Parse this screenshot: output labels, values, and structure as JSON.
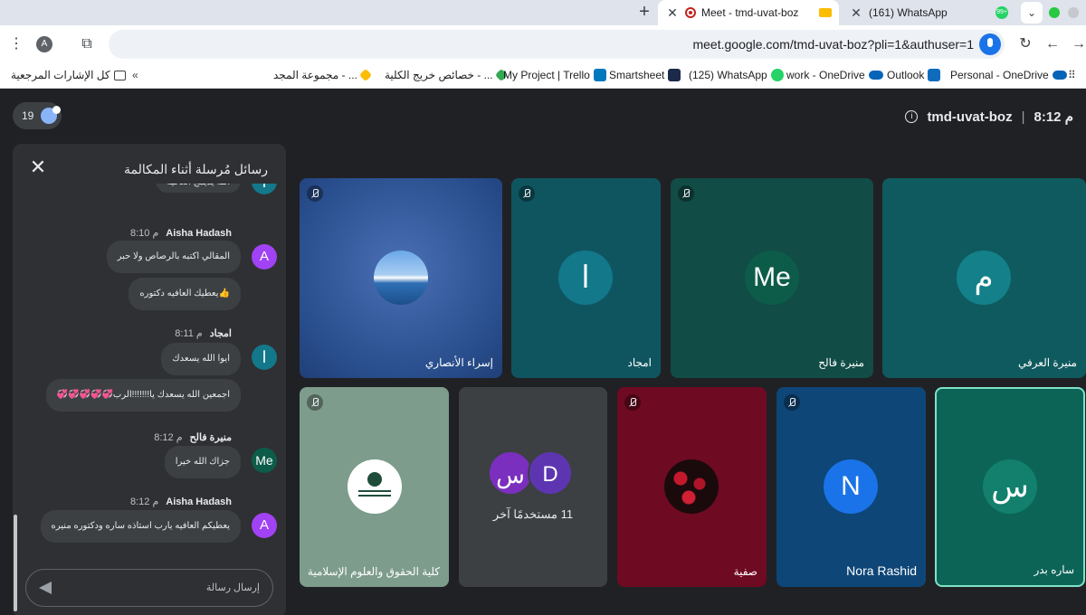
{
  "browser": {
    "tabs": [
      {
        "title": "Meet - tmd-uvat-boz",
        "active": true
      },
      {
        "title": "(161) WhatsApp",
        "active": false
      }
    ],
    "profile_initial": "A",
    "url": "meet.google.com/tmd-uvat-boz?pli=1&authuser=1",
    "bookmarks": [
      "كل الإشارات المرجعية",
      "مجموعة المجد - ...",
      "خصائص خريج الكلية - ...",
      "My Project | Trello",
      "Smartsheet",
      "(125) WhatsApp",
      "work - OneDrive",
      "Outlook",
      "Personal - OneDrive"
    ],
    "wa_badge": "99+"
  },
  "meet": {
    "participant_count": "19",
    "meeting_code": "tmd-uvat-boz",
    "time": "8:12 م",
    "separator": "|",
    "chat": {
      "title": "رسائل مُرسلة أثناء المكالمة",
      "input_placeholder": "إرسال رسالة",
      "top_partial_message": "الله يديمج العافيه",
      "groups": [
        {
          "sender": "Aisha Hadash",
          "time": "8:10 م",
          "avatar": "A",
          "messages": [
            "المقالي اكتبه بالرصاص ولا حبر",
            "👍يعطيك العافيه دكتوره"
          ]
        },
        {
          "sender": "امجاد",
          "time": "8:11 م",
          "avatar": "ا",
          "messages": [
            "ايوا الله يسعدك",
            "اجمعين الله يسعدك يا!!!!!!!الرب💞💞💞💞💞"
          ]
        },
        {
          "sender": "منيرة فالح",
          "time": "8:12 م",
          "avatar": "Me",
          "messages": [
            "جزاك الله خيرا"
          ]
        },
        {
          "sender": "Aisha Hadash",
          "time": "8:12 م",
          "avatar": "A",
          "messages": [
            "يعطيكم العافيه يارب استاذه ساره ودكتوره منيره"
          ]
        }
      ]
    },
    "tiles": [
      {
        "name": "إسراء الأنصاري",
        "initial": ""
      },
      {
        "name": "امجاد",
        "initial": "ا"
      },
      {
        "name": "منيرة فالح",
        "initial": "Me"
      },
      {
        "name": "منيرة العرفي",
        "initial": "م"
      },
      {
        "name": "كلية الحقوق والعلوم الإسلامية",
        "initial": ""
      },
      {
        "name": "11 مستخدمًا آخر",
        "initial_1": "س",
        "initial_2": "D"
      },
      {
        "name": "صفية",
        "initial": ""
      },
      {
        "name": "Nora Rashid",
        "initial": "N"
      },
      {
        "name": "ساره بدر",
        "initial": "س"
      }
    ]
  }
}
